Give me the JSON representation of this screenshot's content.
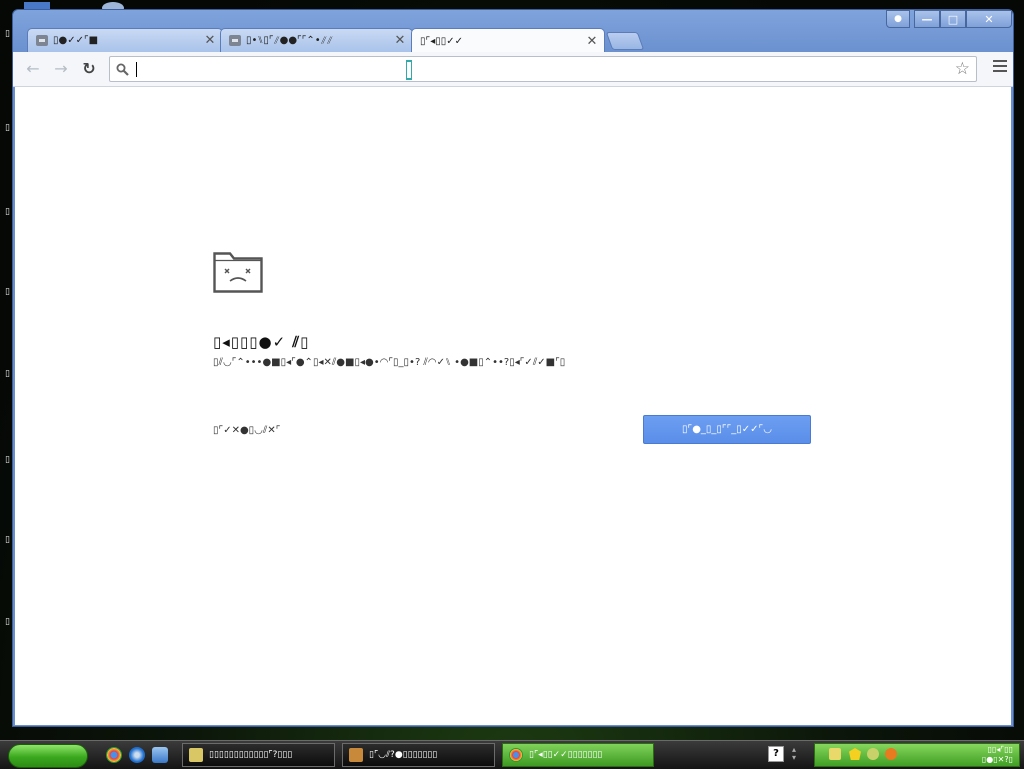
{
  "window": {
    "tabs": [
      {
        "title": "▯●✓✓⌜■",
        "close": "✕",
        "active": false
      },
      {
        "title": "▯•⑊▯⌜⫽●●⌜⌜⌃•⫽⫽",
        "close": "✕",
        "active": false
      },
      {
        "title": "▯⌜◂▯▯✓✓",
        "close": "✕",
        "active": true
      }
    ],
    "controls": {
      "user": "👤",
      "minimize": "—",
      "maximize": "□",
      "close": "✕"
    }
  },
  "toolbar": {
    "back": "←",
    "forward": "→",
    "reload": "↻",
    "omnibox": {
      "value": "",
      "placeholder": ""
    },
    "bookmark_star": "☆"
  },
  "error_page": {
    "title": "▯◂▯▯▯●✓ ⫽▯",
    "message": "▯⫽◡⌜⌃•••●■▯◂⌜●⌃▯◂✕⫽●■▯◂●•◠⌜▯_▯•? ⫽◠✓⑊ •●■▯⌃••?▯◂⌜✓⫽✓■⌜▯",
    "details_link": "▯⌜✓✕●▯◡⫽✕⌜",
    "reload_button": "▯⌜●_▯_▯⌜⌜_▯✓✓⌜◡"
  },
  "taskbar": {
    "items": [
      {
        "label": "▯▯▯▯▯▯▯▯▯▯▯▯⌜?▯▯▯",
        "active": false,
        "icon_color": "#d9c766"
      },
      {
        "label": "▯⌜◡⫽?●▯▯▯▯▯▯▯",
        "active": false,
        "icon_color": "#c88a3a"
      },
      {
        "label": "▯⌜◂▯▯✓✓▯▯▯▯▯▯▯",
        "active": true,
        "icon_color": "#e4b23a"
      }
    ],
    "clock": {
      "line1": "▯▯◂⌜▯▯",
      "line2": "▯●▯✕?▯"
    }
  },
  "colors": {
    "accent": "#5a8ee8",
    "window_frame": "#6d8fc9",
    "taskbar_active": "#3d9a22"
  }
}
